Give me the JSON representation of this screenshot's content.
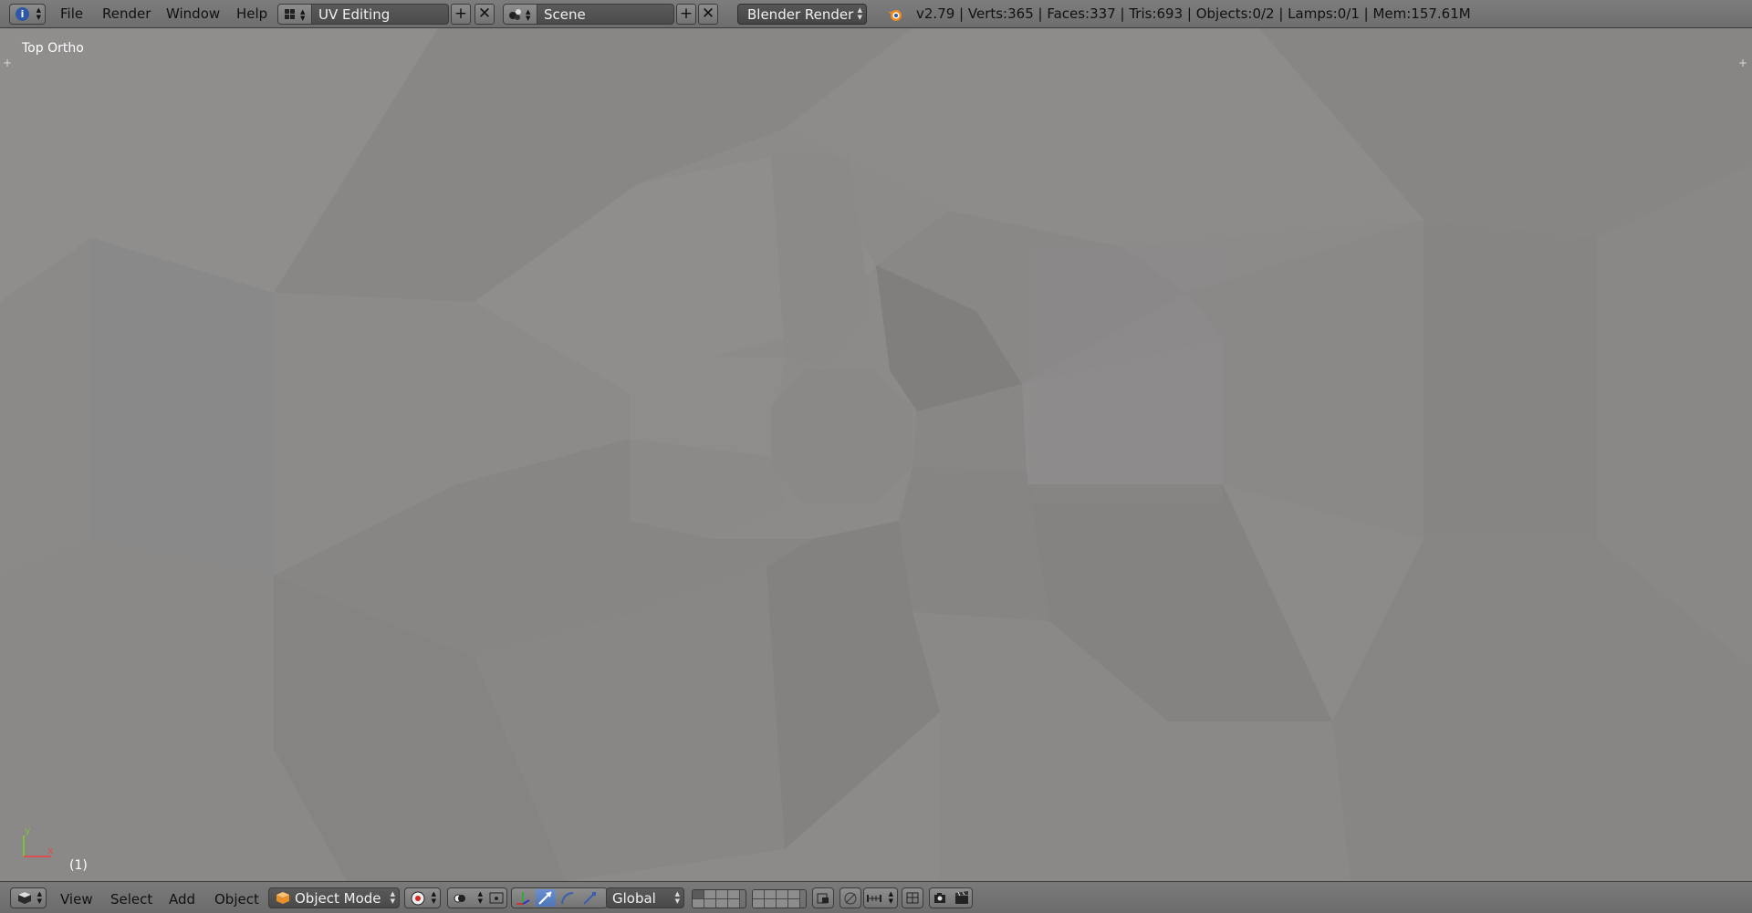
{
  "top_header": {
    "menus": [
      "File",
      "Render",
      "Window",
      "Help"
    ],
    "screen_layout": "UV Editing",
    "scene": "Scene",
    "render_engine": "Blender Render",
    "stats": "v2.79 | Verts:365 | Faces:337 | Tris:693 | Objects:0/2 | Lamps:0/1 | Mem:157.61M"
  },
  "viewport": {
    "view_label": "Top Ortho",
    "frame_label": "(1)",
    "axis_y": "y",
    "axis_x": "x"
  },
  "bottom_header": {
    "menus": [
      "View",
      "Select",
      "Add",
      "Object"
    ],
    "mode": "Object Mode",
    "orientation": "Global"
  },
  "colors": {
    "header_bg": "#727272",
    "viewport_bg": "#8a8988",
    "field_dark": "#4f4f4f",
    "accent_blue": "#5680c2"
  }
}
